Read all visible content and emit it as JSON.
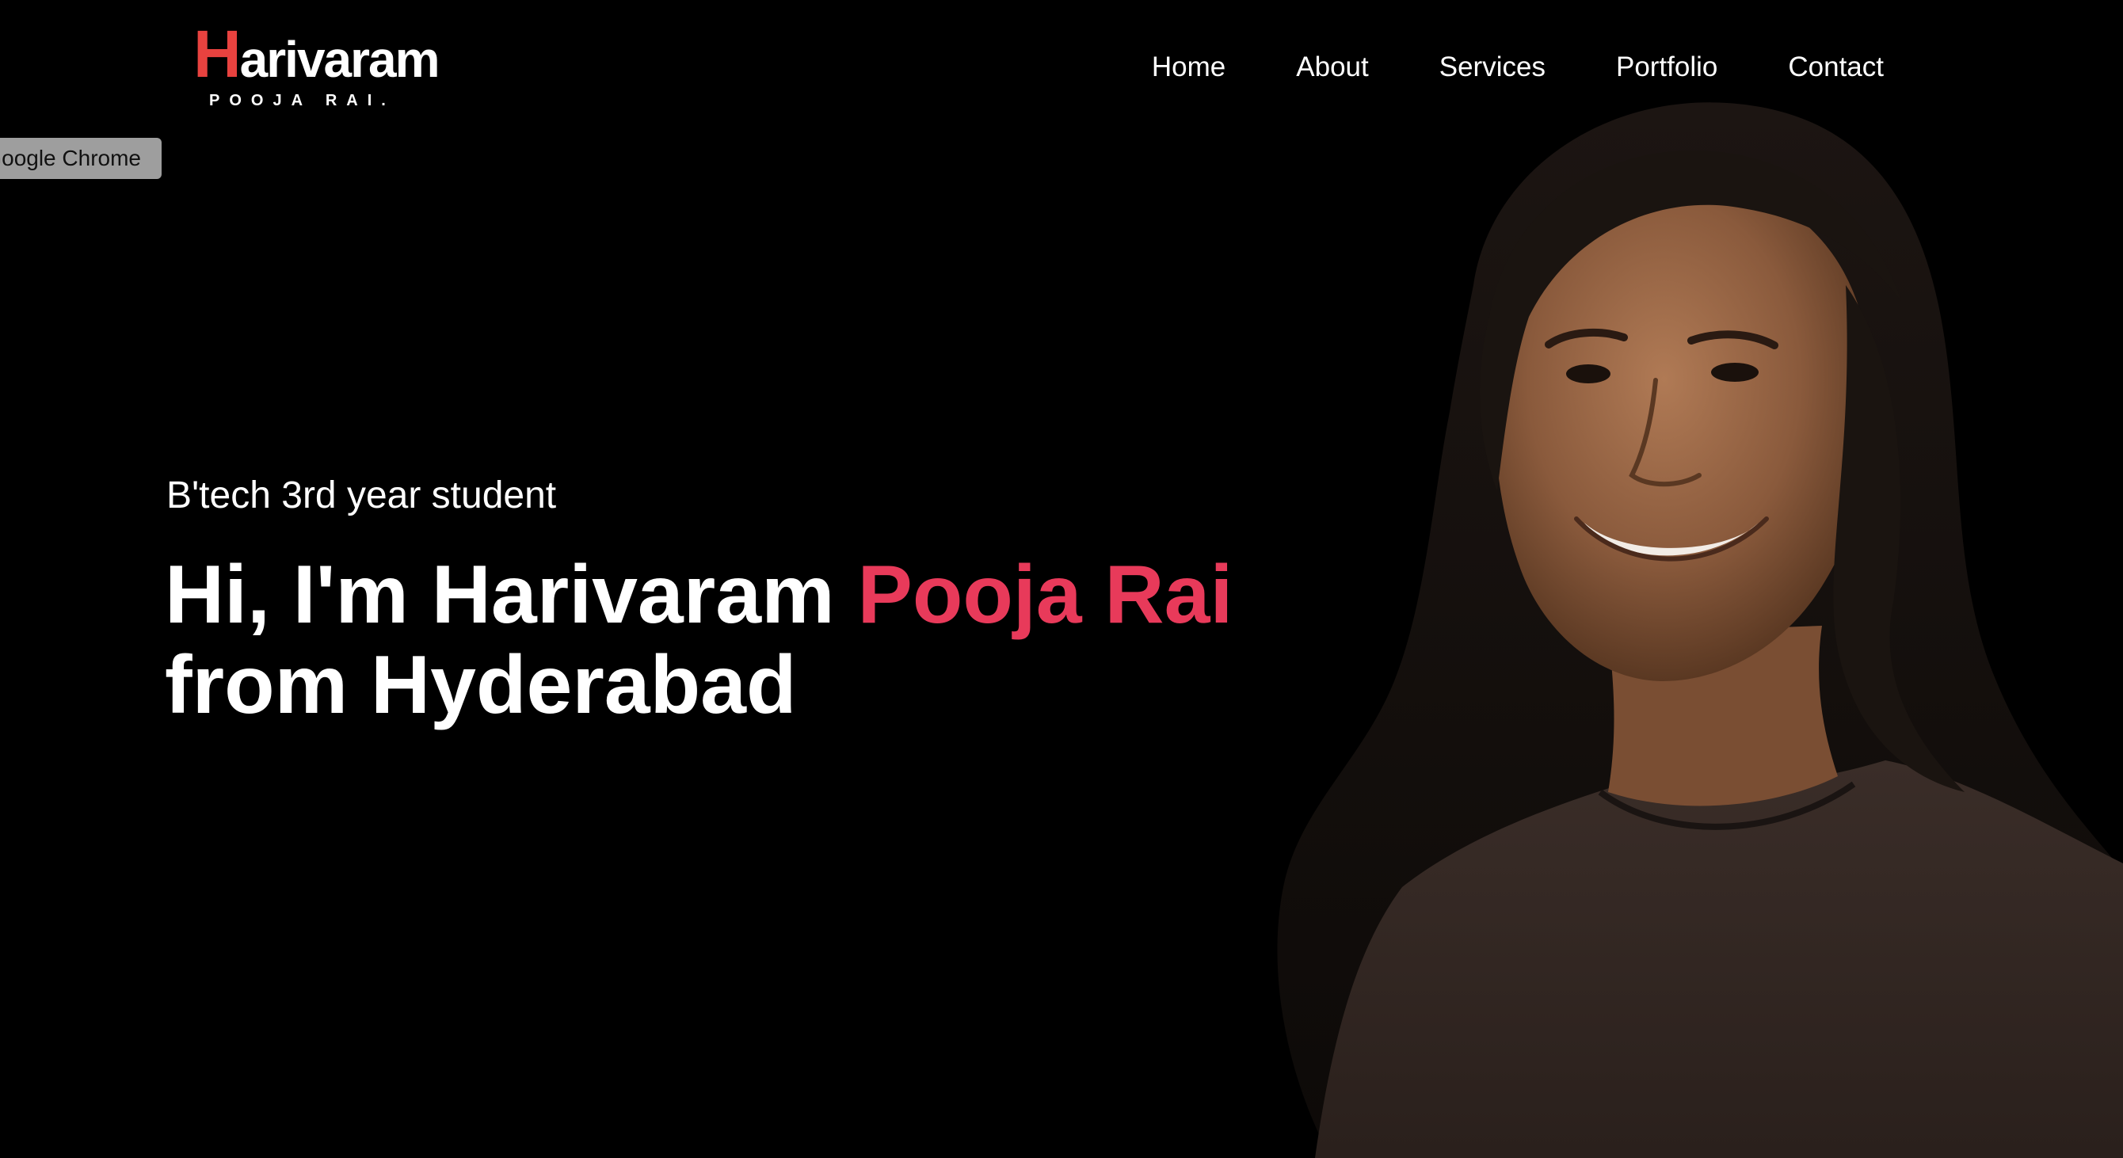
{
  "logo": {
    "initial": "H",
    "name_rest": "arivaram",
    "subtitle": "POOJA RAI."
  },
  "nav": {
    "items": [
      {
        "label": "Home"
      },
      {
        "label": "About"
      },
      {
        "label": "Services"
      },
      {
        "label": "Portfolio"
      },
      {
        "label": "Contact"
      }
    ]
  },
  "tooltip": {
    "text": "Google Chrome"
  },
  "hero": {
    "subtitle": "B'tech 3rd year student",
    "title_prefix": "Hi, I'm Harivaram ",
    "title_accent": "Pooja Rai",
    "title_line2": "from Hyderabad"
  },
  "colors": {
    "background": "#000000",
    "logo_accent": "#e8423f",
    "name_accent": "#e83a5a",
    "text": "#ffffff",
    "tooltip_bg": "#9e9e9e"
  },
  "icons": {
    "portrait": "person-photo"
  }
}
